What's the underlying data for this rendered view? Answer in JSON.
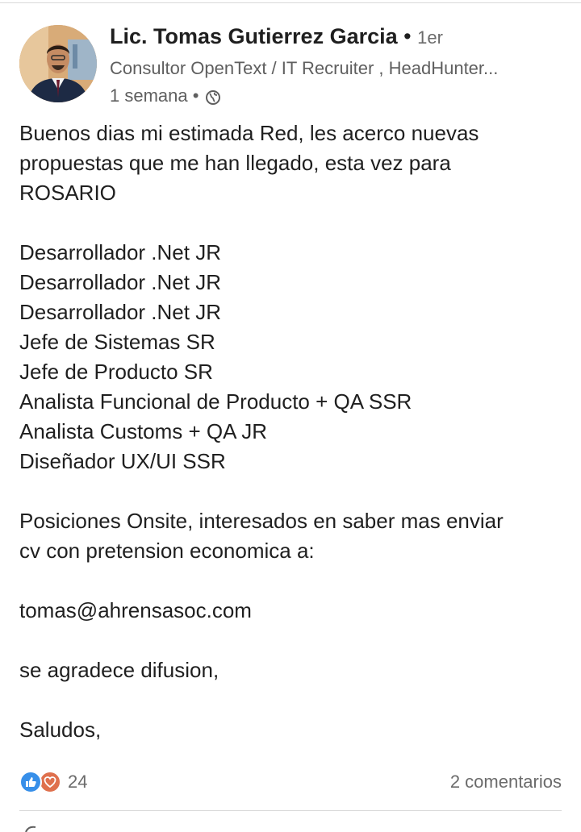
{
  "post": {
    "author": {
      "name": "Lic. Tomas Gutierrez Garcia",
      "degree": "1er",
      "headline": "Consultor OpenText / IT Recruiter , HeadHunter...",
      "posted": "1 semana",
      "visibility_icon": "globe-icon"
    },
    "body": {
      "intro": [
        "Buenos dias mi estimada Red, les acerco nuevas",
        "propuestas que me han llegado, esta vez para",
        "ROSARIO"
      ],
      "positions": [
        "Desarrollador .Net  JR",
        "Desarrollador .Net  JR",
        "Desarrollador .Net  JR",
        "Jefe de Sistemas SR",
        "Jefe de Producto SR",
        "Analista Funcional de Producto + QA SSR",
        "Analista Customs + QA  JR",
        "Diseñador UX/UI  SSR"
      ],
      "onsite": [
        "Posiciones Onsite, interesados en saber mas enviar",
        "cv con pretension economica a:"
      ],
      "email": "tomas@ahrensasoc.com",
      "share_request": "se agradece difusion,",
      "closing": "Saludos,"
    },
    "social": {
      "reaction_icons": [
        "like-icon",
        "love-icon"
      ],
      "reaction_count": "24",
      "comments": "2 comentarios"
    }
  },
  "colors": {
    "text": "#1f1f1f",
    "secondary_text": "#5f5f5f",
    "like_blue": "#378fe9",
    "love_orange": "#df704d",
    "divider": "#d9d9d9"
  }
}
